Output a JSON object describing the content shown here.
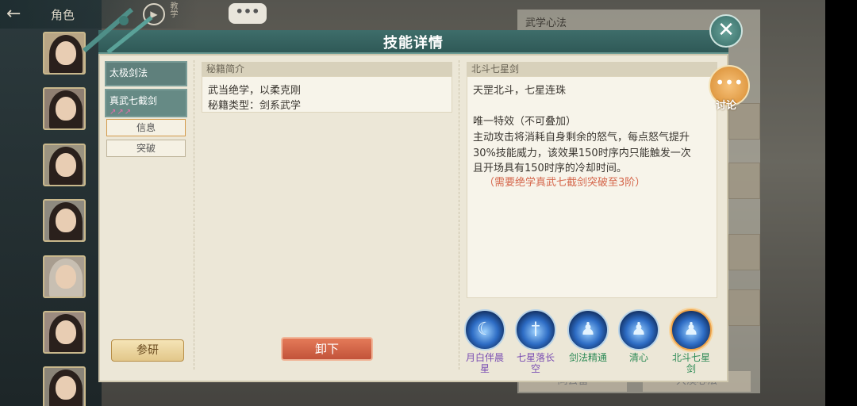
{
  "topbar": {
    "back_icon": "back-arrow-icon",
    "role_label": "角色",
    "play_icon": "play-circle-icon",
    "tutorial_label": "教学",
    "chat_icon": "chat-bubble-icon",
    "chat_label": "•••"
  },
  "background": {
    "panel_title": "武学心法",
    "buttons": [
      "同去留",
      "大漠心法"
    ]
  },
  "modal": {
    "title": "技能详情",
    "close_icon": "close-x-icon",
    "close_label": "✕"
  },
  "left_tabs": {
    "skills": [
      {
        "label": "太极剑法",
        "stars": ""
      },
      {
        "label": "真武七截剑",
        "stars": "↗↗↗"
      }
    ],
    "subtabs": [
      "信息",
      "突破"
    ],
    "research_label": "参研"
  },
  "intro": {
    "header": "秘籍简介",
    "lines": [
      "武当绝学，以柔克刚",
      "秘籍类型：剑系武学"
    ],
    "unload_label": "卸下"
  },
  "detail": {
    "header": "北斗七星剑",
    "lines": [
      "天罡北斗，七星连珠",
      "",
      "唯一特效（不可叠加）",
      "主动攻击将消耗自身剩余的怒气，每点怒气提升",
      "30%技能威力，该效果150时序内只能触发一次",
      "且开场具有150时序的冷却时间。"
    ],
    "requirement": "（需要绝学真武七截剑突破至3阶）"
  },
  "skills": [
    {
      "name": "月白伴晨星",
      "color": "#7b4fb3",
      "icon": "crescent-blade-icon"
    },
    {
      "name": "七星落长空",
      "color": "#7b4fb3",
      "icon": "sword-circle-icon"
    },
    {
      "name": "剑法精通",
      "color": "#2e8b57",
      "icon": "figure-icon"
    },
    {
      "name": "清心",
      "color": "#2e8b57",
      "icon": "figure-icon"
    },
    {
      "name": "北斗七星剑",
      "color": "#2e8b57",
      "icon": "figure-icon"
    }
  ],
  "discuss": {
    "icon": "discussion-icon",
    "label": "讨论"
  }
}
